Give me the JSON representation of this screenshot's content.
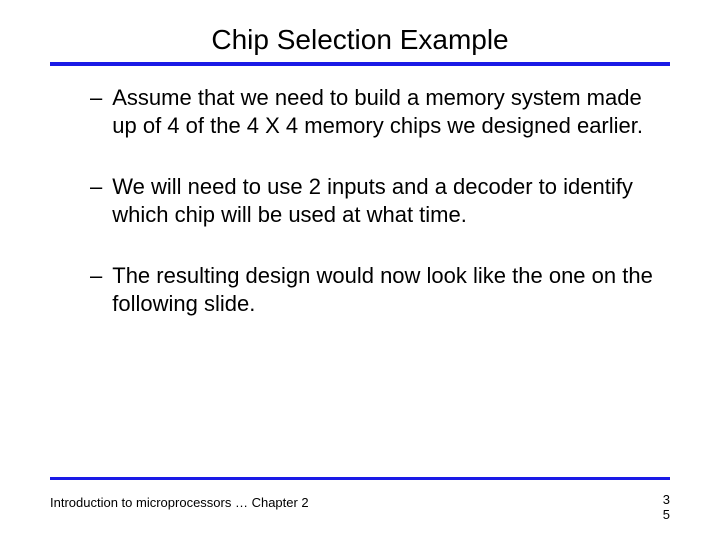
{
  "title": "Chip Selection Example",
  "bullets": {
    "b0": "Assume that we need to build a memory system made up of 4 of the 4 X 4 memory chips we designed earlier.",
    "b1": "We will need to use 2 inputs and a decoder to identify which chip will be used at what time.",
    "b2": "The resulting design would now look like the one on the following slide."
  },
  "footer": "Introduction to microprocessors … Chapter 2",
  "page": {
    "top": "3",
    "bottom": "5"
  }
}
